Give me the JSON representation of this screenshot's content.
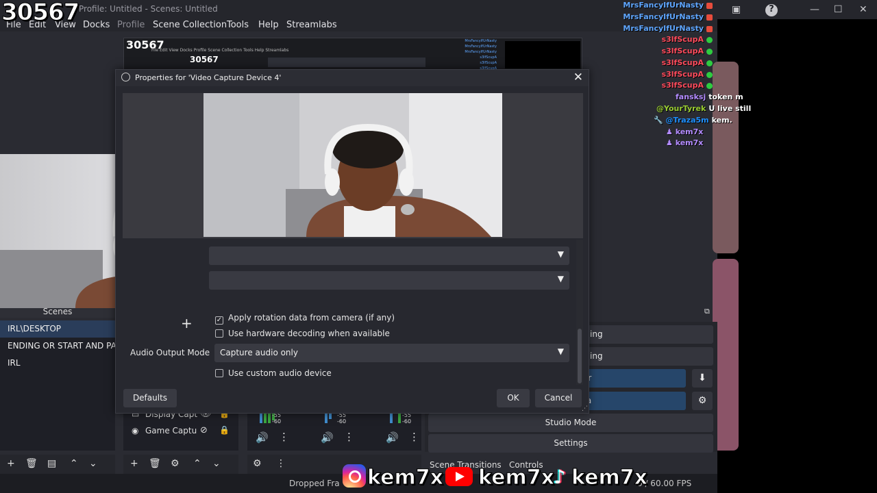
{
  "overlay": {
    "kill_count": "30567"
  },
  "window": {
    "title": "Profile: Untitled - Scenes: Untitled",
    "menu": [
      "File",
      "Edit",
      "View",
      "Docks",
      "Profile",
      "Scene Collection",
      "Tools",
      "Help",
      "Streamlabs"
    ]
  },
  "nested": {
    "kill_count": "30567",
    "kill_count_small": "30567",
    "menu": "File   Edit   View   Docks   Profile   Scene Collection   Tools   Help   Streamlabs"
  },
  "chat": {
    "messages": [
      {
        "user": "MrsFancyIfUrNasty",
        "text": "",
        "color": "#5fa6ff",
        "badge": "#e74c3c"
      },
      {
        "user": "MrsFancyIfUrNasty",
        "text": "",
        "color": "#5fa6ff",
        "badge": "#e74c3c"
      },
      {
        "user": "MrsFancyIfUrNasty",
        "text": "",
        "color": "#5fa6ff",
        "badge": "#e74c3c"
      },
      {
        "user": "s3lfScupA",
        "text": "",
        "color": "#ff4b5c",
        "badge": "#2ecc40"
      },
      {
        "user": "s3lfScupA",
        "text": "",
        "color": "#ff4b5c",
        "badge": "#2ecc40"
      },
      {
        "user": "s3lfScupA",
        "text": "",
        "color": "#ff4b5c",
        "badge": "#2ecc40"
      },
      {
        "user": "s3lfScupA",
        "text": "",
        "color": "#ff4b5c",
        "badge": "#2ecc40"
      },
      {
        "user": "s3lfScupA",
        "text": "",
        "color": "#ff4b5c",
        "badge": "#2ecc40"
      },
      {
        "user": "fansksj",
        "text": "token m",
        "color": "#b38bff",
        "badge": ""
      },
      {
        "user": "@YourTyrek",
        "text": "U live still",
        "color": "#9acd32",
        "badge": ""
      },
      {
        "user": "@Traza5m",
        "text": "kem.",
        "color": "#1e90ff",
        "badge": ""
      },
      {
        "user": "kem7x",
        "text": "",
        "color": "#b38bff",
        "badge": ""
      },
      {
        "user": "kem7x",
        "text": "",
        "color": "#b38bff",
        "badge": ""
      }
    ]
  },
  "dialog": {
    "title": "Properties for 'Video Capture Device 4'",
    "dropdown1": "",
    "dropdown2": "",
    "apply_rotation_label": "Apply rotation data from camera (if any)",
    "apply_rotation_checked": "✓",
    "hw_decoding_label": "Use hardware decoding when available",
    "audio_output_mode_label": "Audio Output Mode",
    "audio_output_mode_value": "Capture audio only",
    "custom_audio_label": "Use custom audio device",
    "defaults_button": "Defaults",
    "ok_button": "OK",
    "cancel_button": "Cancel"
  },
  "scenes": {
    "header": "Scenes",
    "items": [
      "IRL\\DESKTOP",
      "ENDING OR START AND PAUSE",
      "IRL"
    ]
  },
  "sources": {
    "items": [
      {
        "label": "Display Capture"
      },
      {
        "label": "Game Capture"
      }
    ]
  },
  "mixer": {
    "channels": [
      {
        "db_top": "-55",
        "db_bottom": "-60"
      },
      {
        "db_top": "-55",
        "db_bottom": "-60"
      },
      {
        "db_top": "-55",
        "db_bottom": "-60"
      }
    ]
  },
  "controls": {
    "row1": "ing",
    "row2": "ing",
    "row3": "er",
    "row4": "ra",
    "studio_mode": "Studio Mode",
    "settings": "Settings"
  },
  "tabs": {
    "scene_transitions": "Scene Transitions",
    "controls": "Controls"
  },
  "status": {
    "dropped_frames": "Dropped Fra",
    "fps": "0 / 60.00 FPS"
  },
  "socials": {
    "handle1": "kem7x",
    "handle2": "kem7x",
    "handle3": "kem7x"
  },
  "colors": {
    "accent_blue": "#26466a",
    "selection": "#2a3d5a",
    "dialog_bg": "#27282f"
  }
}
